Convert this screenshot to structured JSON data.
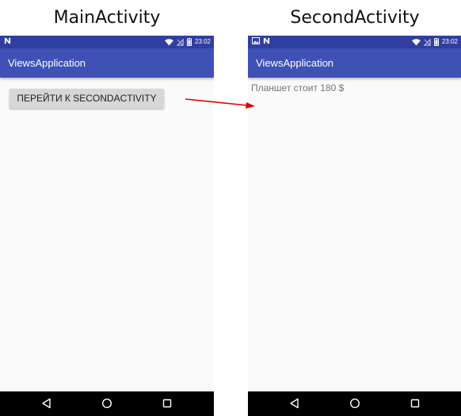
{
  "captions": {
    "left": "MainActivity",
    "right": "SecondActivity"
  },
  "status_bar": {
    "time": "23:02",
    "color": "#303f9f"
  },
  "app_bar": {
    "title": "ViewsApplication",
    "color": "#3f51b5"
  },
  "main_activity": {
    "button_label": "ПЕРЕЙТИ К SECONDACTIVITY"
  },
  "second_activity": {
    "text": "Планшет стоит 180 $"
  },
  "nav_bar": {
    "icons": [
      "back-icon",
      "home-icon",
      "recents-icon"
    ]
  },
  "arrow_color": "#e00000"
}
